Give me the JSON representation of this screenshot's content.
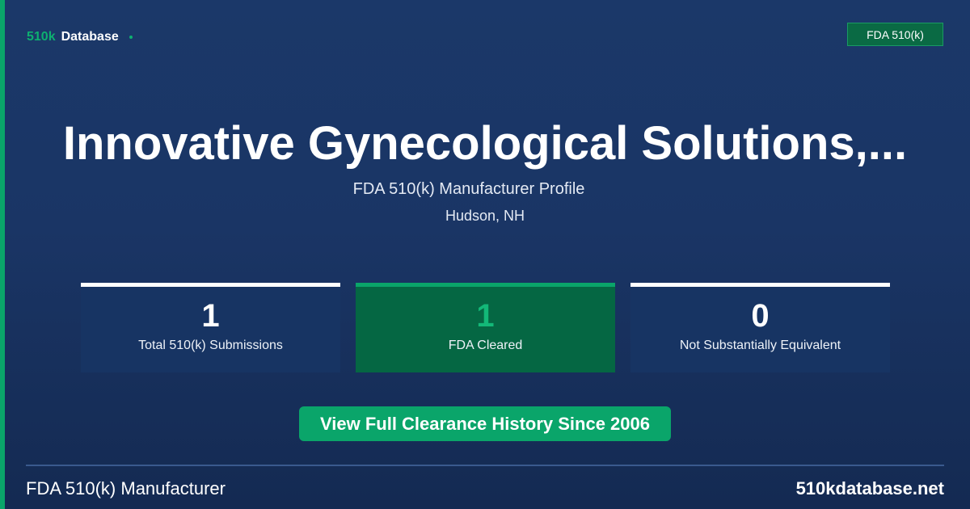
{
  "brand": {
    "primary": "510k",
    "secondary": "Database"
  },
  "badge": {
    "label": "FDA 510(k)"
  },
  "manufacturer": {
    "name": "Innovative Gynecological Solutions,...",
    "profile_label": "FDA 510(k) Manufacturer Profile",
    "location": "Hudson, NH"
  },
  "stats": [
    {
      "value": "1",
      "label": "Total 510(k) Submissions"
    },
    {
      "value": "1",
      "label": "FDA Cleared"
    },
    {
      "value": "0",
      "label": "Not Substantially Equivalent"
    }
  ],
  "cta": {
    "label": "View Full Clearance History Since 2006"
  },
  "footer": {
    "left": "FDA 510(k) Manufacturer",
    "right": "510kdatabase.net"
  },
  "colors": {
    "background": "#1a3565",
    "accent_green": "#0aa56a",
    "highlight_card": "#056743",
    "card": "#173463"
  }
}
